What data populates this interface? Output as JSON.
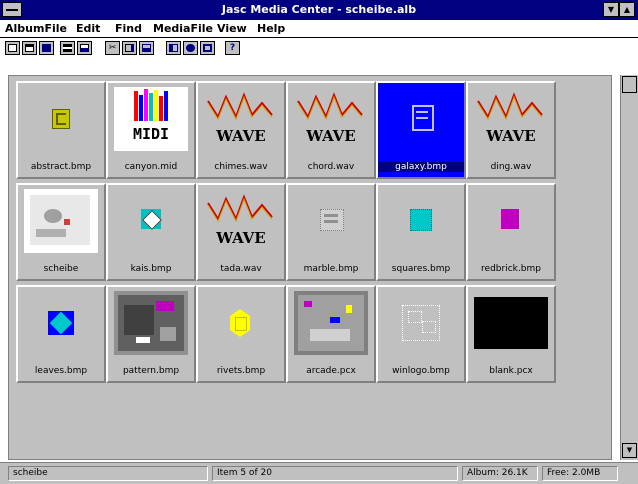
{
  "window": {
    "title": "Jasc Media Center - scheibe.alb",
    "minimize_glyph": "▼",
    "maximize_glyph": "▲"
  },
  "menu": {
    "items": [
      "AlbumFile",
      "Edit",
      "Find",
      "MediaFile",
      "View",
      "Help"
    ]
  },
  "toolbar": {
    "buttons": [
      "new-icon",
      "open-icon",
      "save-icon",
      "close-icon",
      "print-icon",
      "cut-icon",
      "copy-icon",
      "paste-icon",
      "edit-icon",
      "info-icon",
      "view-icon",
      "help-icon"
    ]
  },
  "album": {
    "items": [
      {
        "caption": "abstract.bmp",
        "kind": "image",
        "selected": false
      },
      {
        "caption": "canyon.mid",
        "kind": "midi",
        "selected": false
      },
      {
        "caption": "chimes.wav",
        "kind": "wave",
        "selected": false
      },
      {
        "caption": "chord.wav",
        "kind": "wave",
        "selected": false
      },
      {
        "caption": "galaxy.bmp",
        "kind": "image",
        "selected": true
      },
      {
        "caption": "ding.wav",
        "kind": "wave",
        "selected": false
      },
      {
        "caption": "scheibe",
        "kind": "image",
        "selected": false
      },
      {
        "caption": "kais.bmp",
        "kind": "image",
        "selected": false
      },
      {
        "caption": "tada.wav",
        "kind": "wave",
        "selected": false
      },
      {
        "caption": "marble.bmp",
        "kind": "image",
        "selected": false
      },
      {
        "caption": "squares.bmp",
        "kind": "image",
        "selected": false
      },
      {
        "caption": "redbrick.bmp",
        "kind": "image",
        "selected": false
      },
      {
        "caption": "leaves.bmp",
        "kind": "image",
        "selected": false
      },
      {
        "caption": "pattern.bmp",
        "kind": "image",
        "selected": false
      },
      {
        "caption": "rivets.bmp",
        "kind": "image",
        "selected": false
      },
      {
        "caption": "arcade.pcx",
        "kind": "image",
        "selected": false
      },
      {
        "caption": "winlogo.bmp",
        "kind": "image",
        "selected": false
      },
      {
        "caption": "blank.pcx",
        "kind": "image",
        "selected": false
      }
    ],
    "wave_label": "WAVE",
    "midi_label": "MIDI"
  },
  "statusbar": {
    "album_name": "scheibe",
    "item_info": "Item 5 of 20",
    "memory": "Album: 26.1K",
    "free": "Free: 2.0MB"
  },
  "colors": {
    "titlebar": "#000080",
    "album_bg": "#c0c0c0",
    "selected": "#0000ff"
  }
}
